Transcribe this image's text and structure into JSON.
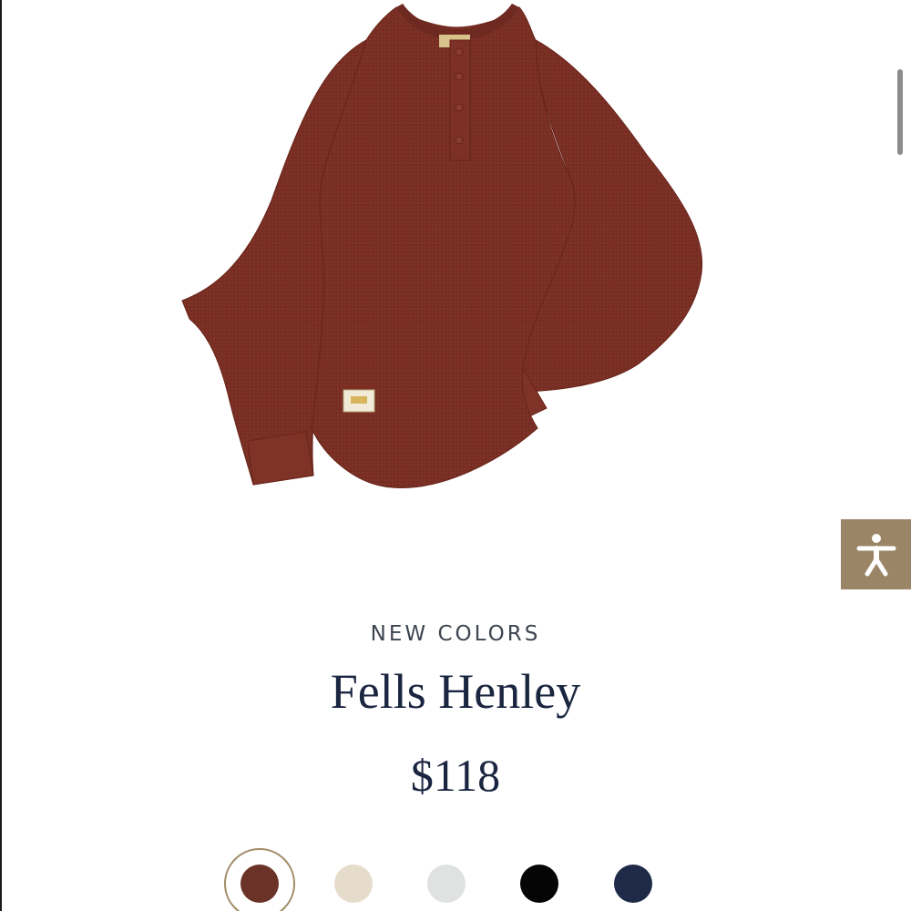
{
  "product": {
    "badge": "NEW COLORS",
    "name": "Fells Henley",
    "price": "$118"
  },
  "product_image": {
    "subject": "long sleeve henley shirt",
    "color": "#7a2f24"
  },
  "accessibility_button": {
    "icon": "accessibility-icon",
    "background": "#9a8566"
  },
  "swatches": [
    {
      "color": "#6b3227",
      "selected": true
    },
    {
      "color": "#e6dccb",
      "selected": false
    },
    {
      "color": "#dfe2e1",
      "selected": false
    },
    {
      "color": "#050505",
      "selected": false
    },
    {
      "color": "#1e2a48",
      "selected": false
    }
  ],
  "colors": {
    "text_primary": "#1a2540",
    "badge_text": "#3d4551",
    "selected_ring": "#a28b66"
  }
}
